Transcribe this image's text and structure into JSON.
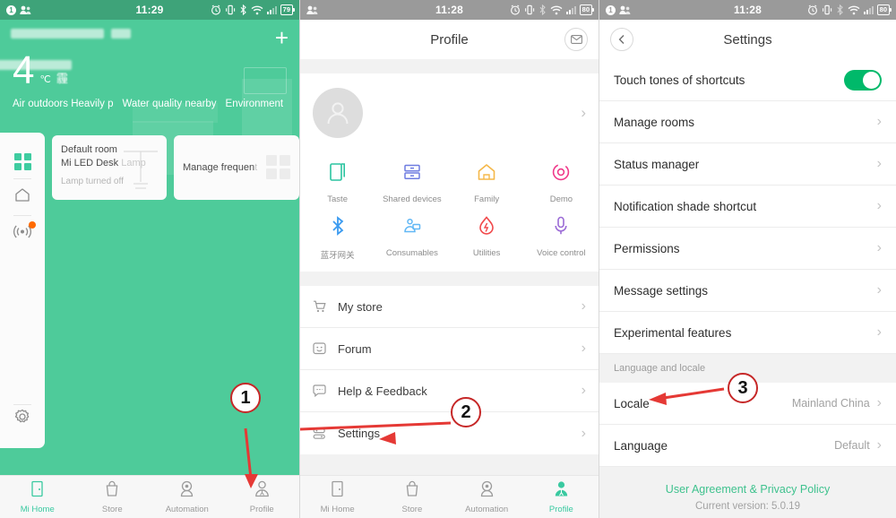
{
  "meta": {
    "accent_green": "#4ECB9A",
    "callout_red": "#E53935",
    "toggle_on": "#00B96A"
  },
  "panel1": {
    "name": "mi-home-dashboard",
    "statusbar": {
      "time": "11:29",
      "battery": "79",
      "notif_count": "1"
    },
    "header": {
      "account_placeholder": "",
      "add_label": "+"
    },
    "weather": {
      "temperature": "4",
      "unit": "℃",
      "cn_word": "霾",
      "city_placeholder": "",
      "metrics": [
        "Air outdoors Heavily p",
        "Water quality nearby",
        "Environment hum"
      ]
    },
    "sidebar": {
      "items": [
        {
          "name": "grid-icon",
          "label": ""
        },
        {
          "name": "home-icon",
          "label": ""
        },
        {
          "name": "signal-icon",
          "label": "",
          "badge": true
        },
        {
          "name": "gear-icon",
          "label": ""
        }
      ]
    },
    "cards": [
      {
        "name": "device-card",
        "room": "Default room",
        "device": "Mi LED Desk ",
        "device_dim": "Lamp",
        "status": "Lamp turned off"
      },
      {
        "name": "manage-frequent-card",
        "label": "Manage frequen",
        "label_dim": "t"
      }
    ],
    "tabbar": [
      {
        "label": "Mi Home",
        "icon": "door-icon",
        "active": true
      },
      {
        "label": "Store",
        "icon": "basket-icon",
        "active": false
      },
      {
        "label": "Automation",
        "icon": "camera-icon",
        "active": false
      },
      {
        "label": "Profile",
        "icon": "person-icon",
        "active": false
      }
    ]
  },
  "panel2": {
    "name": "profile-screen",
    "statusbar": {
      "time": "11:28",
      "battery": "80",
      "notif_count": ""
    },
    "navbar": {
      "title": "Profile",
      "mail_icon": "envelope-icon"
    },
    "profile": {
      "name_placeholder": "",
      "subtitle_placeholder": ""
    },
    "shortcuts": [
      {
        "label": "Taste",
        "icon": "taste-icon",
        "color": "#2BC4A0"
      },
      {
        "label": "Shared devices",
        "icon": "shared-devices-icon",
        "color": "#6E7CE0"
      },
      {
        "label": "Family",
        "icon": "family-home-icon",
        "color": "#F5B84A"
      },
      {
        "label": "Demo",
        "icon": "demo-target-icon",
        "color": "#F0398A"
      },
      {
        "label": "蓝牙网关",
        "icon": "bluetooth-icon",
        "color": "#3B9BF0"
      },
      {
        "label": "Consumables",
        "icon": "consumables-icon",
        "color": "#62B8F5"
      },
      {
        "label": "Utilities",
        "icon": "utilities-drop-icon",
        "color": "#F1494B"
      },
      {
        "label": "Voice control",
        "icon": "microphone-icon",
        "color": "#9B6BD6"
      }
    ],
    "menu": [
      {
        "label": "My store",
        "icon": "cart-icon"
      },
      {
        "label": "Forum",
        "icon": "smiley-icon"
      },
      {
        "label": "Help & Feedback",
        "icon": "chat-icon"
      },
      {
        "label": "Settings",
        "icon": "settings-sliders-icon"
      }
    ],
    "tabbar": [
      {
        "label": "Mi Home",
        "icon": "door-icon",
        "active": false
      },
      {
        "label": "Store",
        "icon": "basket-icon",
        "active": false
      },
      {
        "label": "Automation",
        "icon": "camera-icon",
        "active": false
      },
      {
        "label": "Profile",
        "icon": "person-icon",
        "active": true
      }
    ]
  },
  "panel3": {
    "name": "settings-screen",
    "statusbar": {
      "time": "11:28",
      "battery": "80",
      "notif_count": "1"
    },
    "navbar": {
      "title": "Settings",
      "back_icon": "chevron-left-icon"
    },
    "rows": [
      {
        "label": "Touch tones of shortcuts",
        "control": "toggle",
        "value": "on"
      },
      {
        "label": "Manage rooms",
        "control": "chevron",
        "value": ""
      },
      {
        "label": "Status manager",
        "control": "chevron",
        "value": ""
      },
      {
        "label": "Notification shade shortcut",
        "control": "chevron",
        "value": ""
      },
      {
        "label": "Permissions",
        "control": "chevron",
        "value": ""
      },
      {
        "label": "Message settings",
        "control": "chevron",
        "value": ""
      },
      {
        "label": "Experimental features",
        "control": "chevron",
        "value": ""
      }
    ],
    "group_header": "Language and locale",
    "locale_rows": [
      {
        "label": "Locale",
        "value": "Mainland China"
      },
      {
        "label": "Language",
        "value": "Default"
      }
    ],
    "footer": {
      "link": "User Agreement & Privacy Policy",
      "version": "Current version: 5.0.19"
    }
  },
  "callouts": [
    {
      "number": "1",
      "target": "profile-tab"
    },
    {
      "number": "2",
      "target": "settings-menu-item"
    },
    {
      "number": "3",
      "target": "locale-row"
    }
  ]
}
